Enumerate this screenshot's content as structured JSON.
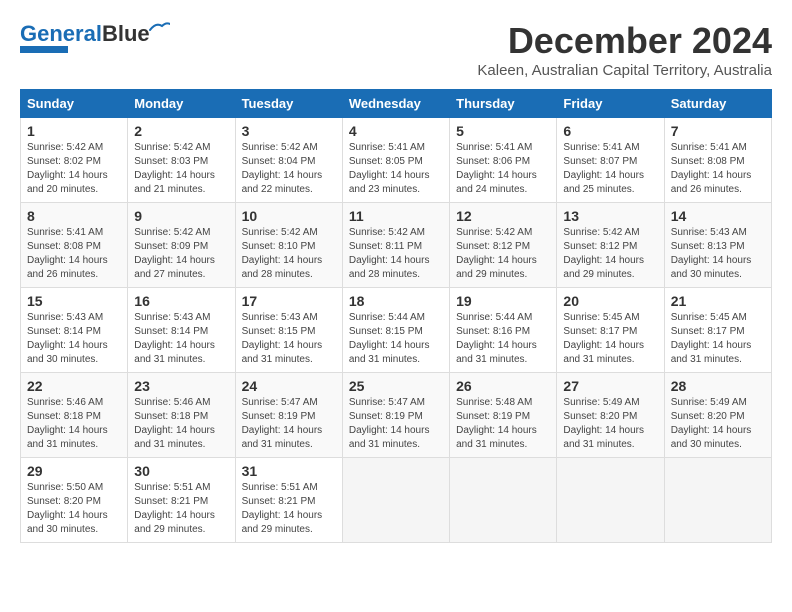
{
  "logo": {
    "text_general": "General",
    "text_blue": "Blue"
  },
  "title": {
    "month": "December 2024",
    "location": "Kaleen, Australian Capital Territory, Australia"
  },
  "days_of_week": [
    "Sunday",
    "Monday",
    "Tuesday",
    "Wednesday",
    "Thursday",
    "Friday",
    "Saturday"
  ],
  "weeks": [
    [
      {
        "day": "1",
        "sunrise": "5:42 AM",
        "sunset": "8:02 PM",
        "daylight": "14 hours and 20 minutes."
      },
      {
        "day": "2",
        "sunrise": "5:42 AM",
        "sunset": "8:03 PM",
        "daylight": "14 hours and 21 minutes."
      },
      {
        "day": "3",
        "sunrise": "5:42 AM",
        "sunset": "8:04 PM",
        "daylight": "14 hours and 22 minutes."
      },
      {
        "day": "4",
        "sunrise": "5:41 AM",
        "sunset": "8:05 PM",
        "daylight": "14 hours and 23 minutes."
      },
      {
        "day": "5",
        "sunrise": "5:41 AM",
        "sunset": "8:06 PM",
        "daylight": "14 hours and 24 minutes."
      },
      {
        "day": "6",
        "sunrise": "5:41 AM",
        "sunset": "8:07 PM",
        "daylight": "14 hours and 25 minutes."
      },
      {
        "day": "7",
        "sunrise": "5:41 AM",
        "sunset": "8:08 PM",
        "daylight": "14 hours and 26 minutes."
      }
    ],
    [
      {
        "day": "8",
        "sunrise": "5:41 AM",
        "sunset": "8:08 PM",
        "daylight": "14 hours and 26 minutes."
      },
      {
        "day": "9",
        "sunrise": "5:42 AM",
        "sunset": "8:09 PM",
        "daylight": "14 hours and 27 minutes."
      },
      {
        "day": "10",
        "sunrise": "5:42 AM",
        "sunset": "8:10 PM",
        "daylight": "14 hours and 28 minutes."
      },
      {
        "day": "11",
        "sunrise": "5:42 AM",
        "sunset": "8:11 PM",
        "daylight": "14 hours and 28 minutes."
      },
      {
        "day": "12",
        "sunrise": "5:42 AM",
        "sunset": "8:12 PM",
        "daylight": "14 hours and 29 minutes."
      },
      {
        "day": "13",
        "sunrise": "5:42 AM",
        "sunset": "8:12 PM",
        "daylight": "14 hours and 29 minutes."
      },
      {
        "day": "14",
        "sunrise": "5:43 AM",
        "sunset": "8:13 PM",
        "daylight": "14 hours and 30 minutes."
      }
    ],
    [
      {
        "day": "15",
        "sunrise": "5:43 AM",
        "sunset": "8:14 PM",
        "daylight": "14 hours and 30 minutes."
      },
      {
        "day": "16",
        "sunrise": "5:43 AM",
        "sunset": "8:14 PM",
        "daylight": "14 hours and 31 minutes."
      },
      {
        "day": "17",
        "sunrise": "5:43 AM",
        "sunset": "8:15 PM",
        "daylight": "14 hours and 31 minutes."
      },
      {
        "day": "18",
        "sunrise": "5:44 AM",
        "sunset": "8:15 PM",
        "daylight": "14 hours and 31 minutes."
      },
      {
        "day": "19",
        "sunrise": "5:44 AM",
        "sunset": "8:16 PM",
        "daylight": "14 hours and 31 minutes."
      },
      {
        "day": "20",
        "sunrise": "5:45 AM",
        "sunset": "8:17 PM",
        "daylight": "14 hours and 31 minutes."
      },
      {
        "day": "21",
        "sunrise": "5:45 AM",
        "sunset": "8:17 PM",
        "daylight": "14 hours and 31 minutes."
      }
    ],
    [
      {
        "day": "22",
        "sunrise": "5:46 AM",
        "sunset": "8:18 PM",
        "daylight": "14 hours and 31 minutes."
      },
      {
        "day": "23",
        "sunrise": "5:46 AM",
        "sunset": "8:18 PM",
        "daylight": "14 hours and 31 minutes."
      },
      {
        "day": "24",
        "sunrise": "5:47 AM",
        "sunset": "8:19 PM",
        "daylight": "14 hours and 31 minutes."
      },
      {
        "day": "25",
        "sunrise": "5:47 AM",
        "sunset": "8:19 PM",
        "daylight": "14 hours and 31 minutes."
      },
      {
        "day": "26",
        "sunrise": "5:48 AM",
        "sunset": "8:19 PM",
        "daylight": "14 hours and 31 minutes."
      },
      {
        "day": "27",
        "sunrise": "5:49 AM",
        "sunset": "8:20 PM",
        "daylight": "14 hours and 31 minutes."
      },
      {
        "day": "28",
        "sunrise": "5:49 AM",
        "sunset": "8:20 PM",
        "daylight": "14 hours and 30 minutes."
      }
    ],
    [
      {
        "day": "29",
        "sunrise": "5:50 AM",
        "sunset": "8:20 PM",
        "daylight": "14 hours and 30 minutes."
      },
      {
        "day": "30",
        "sunrise": "5:51 AM",
        "sunset": "8:21 PM",
        "daylight": "14 hours and 29 minutes."
      },
      {
        "day": "31",
        "sunrise": "5:51 AM",
        "sunset": "8:21 PM",
        "daylight": "14 hours and 29 minutes."
      },
      null,
      null,
      null,
      null
    ]
  ],
  "labels": {
    "sunrise": "Sunrise:",
    "sunset": "Sunset:",
    "daylight": "Daylight:"
  }
}
